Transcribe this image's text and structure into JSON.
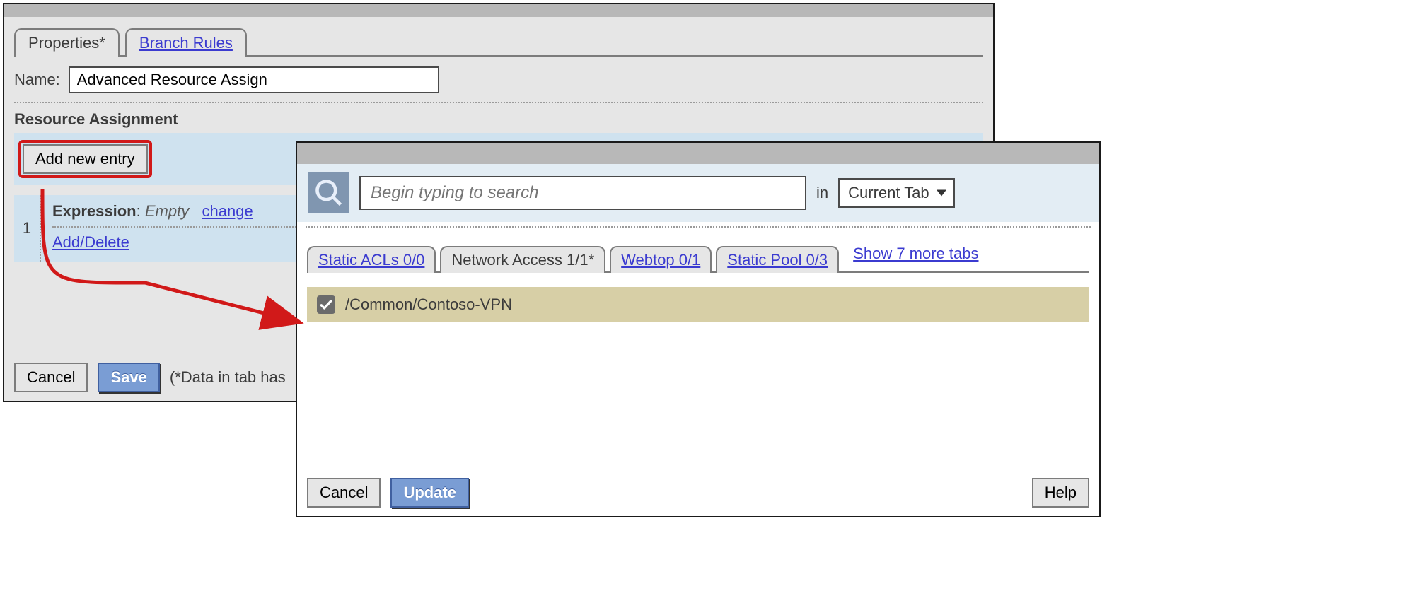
{
  "back": {
    "tabs": {
      "active": "Properties*",
      "inactive": "Branch Rules"
    },
    "name_label": "Name:",
    "name_value": "Advanced Resource Assign",
    "section": "Resource Assignment",
    "add_entry": "Add new entry",
    "entry_index": "1",
    "expr_label": "Expression",
    "expr_value": "Empty",
    "change": "change",
    "add_delete": "Add/Delete",
    "cancel": "Cancel",
    "save": "Save",
    "save_note": "(*Data in tab has"
  },
  "front": {
    "search_placeholder": "Begin typing to search",
    "in_label": "in",
    "scope": "Current Tab",
    "subtabs": {
      "acls": "Static ACLs 0/0",
      "na": "Network Access 1/1*",
      "web": "Webtop 0/1",
      "pool": "Static Pool 0/3"
    },
    "more": "Show 7 more tabs",
    "resource": "/Common/Contoso-VPN",
    "cancel": "Cancel",
    "update": "Update",
    "help": "Help"
  }
}
